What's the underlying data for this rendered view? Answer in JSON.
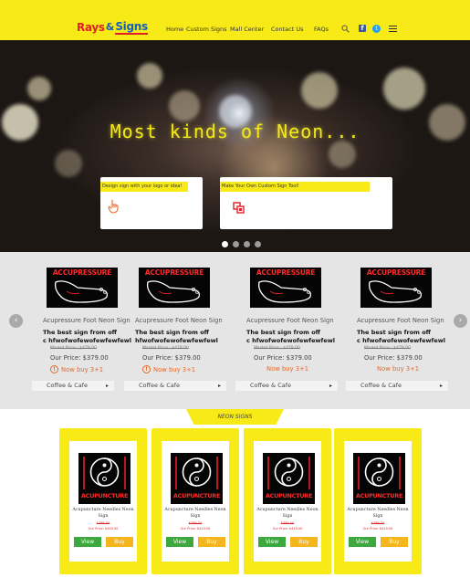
{
  "header": {
    "logo_left": "Rays",
    "logo_amp": "&",
    "logo_right": "Signs",
    "nav": [
      "Home",
      "Custom Signs",
      "Mall Center",
      "Contact Us",
      "FAQs"
    ],
    "icons": [
      "search-icon",
      "facebook-icon",
      "twitter-icon",
      "menu-icon"
    ],
    "facebook_glyph": "f",
    "twitter_glyph": "t"
  },
  "hero": {
    "title": "Most kinds of Neon...",
    "card_left_label": "Design sign with your logo or idea!",
    "card_right_label": "Make Your Own Custom Sign Tool!",
    "slide_count": 4,
    "active_slide": 0
  },
  "colors": {
    "brand_yellow": "#f7ea16",
    "brand_red": "#e21f26",
    "brand_blue": "#1560b8",
    "buy_orange": "#e8682a",
    "view_green": "#3da83d",
    "buy_yellow": "#f5b51c"
  },
  "carousel": {
    "prev_arrow": "‹",
    "next_arrow": "›",
    "products": [
      {
        "image_text": "ACCUPRESSURE",
        "name": "Acupressure Foot Neon Sign",
        "desc_line1": "The best sign from off",
        "desc_line2": "c hfwofwofewofewfewfewl",
        "market_price": "Market Price : $479.00",
        "our_price": "Our Price: $379.00",
        "buy_text": "Now buy 3+1",
        "category": "Coffee & Cafe"
      },
      {
        "image_text": "ACCUPRESSURE",
        "name": "Acupressure Foot Neon Sign",
        "desc_line1": "The best sign from off",
        "desc_line2": "hfwofwofewofewfewfewl",
        "market_price": "Market Price : $479.00",
        "our_price": "Our Price: $379.00",
        "buy_text": "Now buy 3+1",
        "category": "Coffee & Cafe"
      },
      {
        "image_text": "ACCUPRESSURE",
        "name": "Acupressure Foot Neon Sign",
        "desc_line1": "The best sign from off",
        "desc_line2": "c hfwofwofewofewfewfewl",
        "market_price": "Market Price : $479.00",
        "our_price": "Our Price: $379.00",
        "buy_text": "Now buy 3+1",
        "category": "Coffee & Cafe"
      },
      {
        "image_text": "ACCUPRESSURE",
        "name": "Acupressure Foot Neon Sign",
        "desc_line1": "The best sign from off",
        "desc_line2": "c hfwofwofewofewfewfewl",
        "market_price": "Market Price : $479.00",
        "our_price": "Our Price: $379.00",
        "buy_text": "Now buy 3+1",
        "category": "Coffee & Cafe"
      }
    ]
  },
  "neon_signs": {
    "section_label": "NEON SIGNS",
    "items": [
      {
        "image_text": "ACUPUNCTURE",
        "title": "Acupuncture Needles Neon Sign",
        "market_price": "$389.00",
        "our_price": "Our Price: $419.00",
        "view_label": "View",
        "buy_label": "Buy"
      },
      {
        "image_text": "ACUPUNCTURE",
        "title": "Acupuncture Needles Neon Sign",
        "market_price": "$389.00",
        "our_price": "Our Price: $419.00",
        "view_label": "View",
        "buy_label": "Buy"
      },
      {
        "image_text": "ACUPUNCTURE",
        "title": "Acupuncture Needles Neon Sign",
        "market_price": "$389.00",
        "our_price": "Our Price: $419.00",
        "view_label": "View",
        "buy_label": "Buy"
      },
      {
        "image_text": "ACUPUNCTURE",
        "title": "Acupuncture Needles Neon Sign",
        "market_price": "$389.00",
        "our_price": "Our Price: $419.00",
        "view_label": "View",
        "buy_label": "Buy"
      }
    ]
  }
}
